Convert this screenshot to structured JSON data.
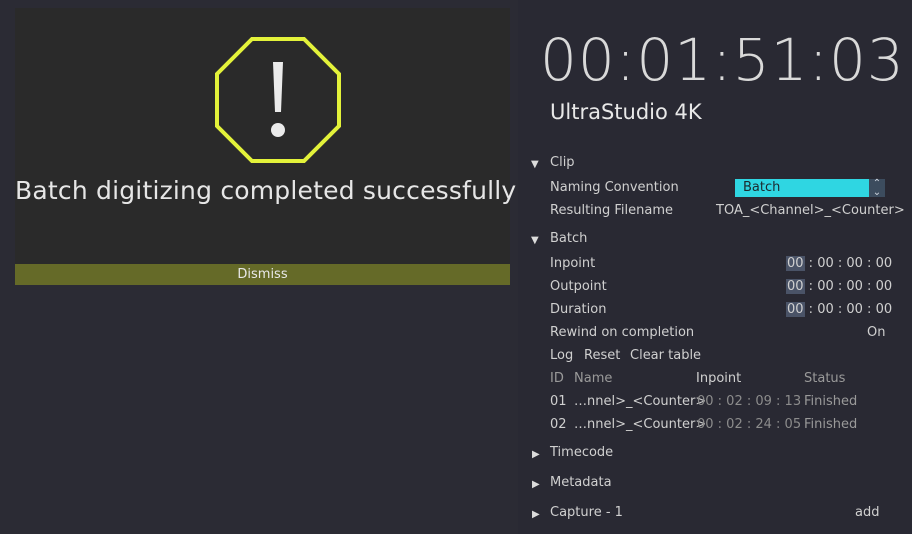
{
  "alert": {
    "message": "Batch digitizing completed successfully!",
    "dismiss_label": "Dismiss",
    "icon": "warning-octagon-icon",
    "icon_color": "#e3f23a"
  },
  "header": {
    "timecode": "00:01:51:03",
    "device": "UltraStudio 4K"
  },
  "clip": {
    "title": "Clip",
    "naming_label": "Naming Convention",
    "naming_value": "Batch",
    "filename_label": "Resulting Filename",
    "filename_value": "TOA_<Channel>_<Counter>"
  },
  "batch": {
    "title": "Batch",
    "inpoint_label": "Inpoint",
    "outpoint_label": "Outpoint",
    "duration_label": "Duration",
    "tc_first": "00",
    "tc_rest": " : 00 : 00 : 00",
    "rewind_label": "Rewind on completion",
    "rewind_value": "On",
    "actions": [
      "Log",
      "Reset",
      "Clear table"
    ],
    "table": {
      "headers": [
        "ID",
        "Name",
        "Inpoint",
        "Status"
      ],
      "rows": [
        {
          "id": "01",
          "name": "…nnel>_<Counter>",
          "inpoint": "00 : 02 : 09 : 13",
          "status": "Finished"
        },
        {
          "id": "02",
          "name": "…nnel>_<Counter>",
          "inpoint": "00 : 02 : 24 : 05",
          "status": "Finished"
        }
      ]
    }
  },
  "sections": {
    "timecode": "Timecode",
    "metadata": "Metadata",
    "capture": "Capture - 1",
    "add_label": "add"
  },
  "colors": {
    "accent_cyan": "#2fd6e2",
    "dismiss_bar": "#656a28",
    "background": "#2b2b34"
  }
}
